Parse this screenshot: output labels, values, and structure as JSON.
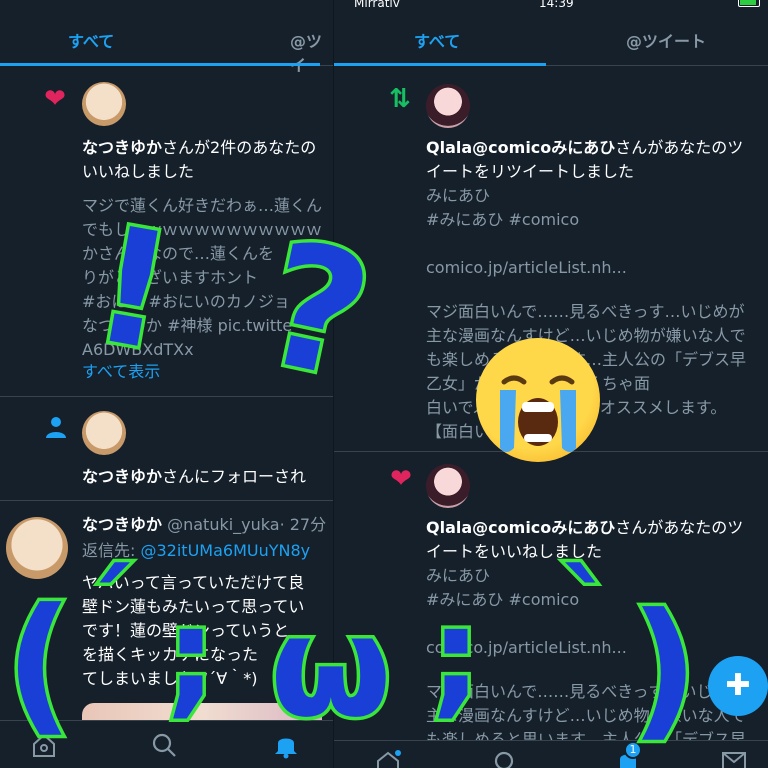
{
  "status_bar": {
    "carrier": "Mirrativ",
    "time": "14:39"
  },
  "left": {
    "tabs": [
      {
        "label": "すべて"
      },
      {
        "label": "@ツイ"
      }
    ],
    "notifications": [
      {
        "type": "like",
        "name": "なつきゆか",
        "text_suffix": "さんが2件のあなたの",
        "text_line2": "いいねしました",
        "preview_lines": [
          "マジで蓮くん好きだわぁ…蓮くん",
          "でもしｗｗｗｗｗｗｗｗｗｗｗｗ",
          "かさん神なので…蓮くんを",
          "りがとございますホント",
          "#おにの #おにいのカノジョ",
          "なつきゆか #神様 pic.twitte",
          "A6DWBXdTXx"
        ],
        "show_all": "すべて表示"
      },
      {
        "type": "follow",
        "name": "なつきゆか",
        "text_suffix": "さんにフォローされ"
      },
      {
        "type": "reply",
        "name": "なつきゆか",
        "handle": "@natuki_yuka",
        "time": "· 27分",
        "reply_to_label": "返信先:",
        "reply_to_handle": "@32itUMa6MUuYN8y",
        "body_lines": [
          "ヤバいって言っていただけて良",
          "壁ドン蓮もみたいって思ってい",
          "です！蓮の壁ドンっていうと",
          "を描くキッカケになった",
          "てしまいました(ﾉ´∀｀*)"
        ]
      }
    ]
  },
  "right": {
    "tabs": [
      {
        "label": "すべて"
      },
      {
        "label": "@ツイート"
      }
    ],
    "notifications": [
      {
        "type": "retweet",
        "name": "Qlala@comicoみにあひ",
        "text_suffix": "さんがあなたのツ",
        "text_line2": "イートをリツイートしました",
        "preview_lines": [
          "みにあひ",
          "#みにあひ #comico",
          "",
          "comico.jp/articleList.nh...",
          "",
          "マジ面白いんで……見るべきっす…いじめが",
          "主な漫画なんすけど…いじめ物が嫌いな人で",
          "も楽しめると思います…主人公の「デブス早",
          "乙女」が性格もめちゃくちゃ面",
          "白いでぷっと笑えます。オススメします。",
          "【面白い"
        ]
      },
      {
        "type": "like",
        "name": "Qlala@comicoみにあひ",
        "text_suffix": "さんがあなたのツ",
        "text_line2": "イートをいいねしました",
        "preview_lines": [
          "みにあひ",
          "#みにあひ #comico",
          "",
          "comico.jp/articleList.nh...",
          "",
          "マジ面白いんで……見るべきっす…いじめが",
          "主な漫画なんすけど…いじめ物が嫌いな人で",
          "も楽しめると思います…主人公の「デブス早"
        ]
      }
    ],
    "notification_badge": "1"
  },
  "overlay": {
    "exclaim": "!",
    "question": "?",
    "kaomoji": [
      "(",
      "´",
      ";",
      "ω",
      ";",
      "`",
      ")"
    ]
  },
  "colors": {
    "background": "#15202b",
    "accent": "#1da1f2",
    "like": "#e0245e",
    "retweet": "#17bf63",
    "muted": "#8899a6",
    "sticker_stroke": "#39e639",
    "sticker_fill": "#1a3fd6"
  },
  "icons": [
    "heart-icon",
    "retweet-icon",
    "person-icon",
    "home-icon",
    "search-icon",
    "bell-icon",
    "mail-icon",
    "compose-icon",
    "crying-face-emoji"
  ]
}
